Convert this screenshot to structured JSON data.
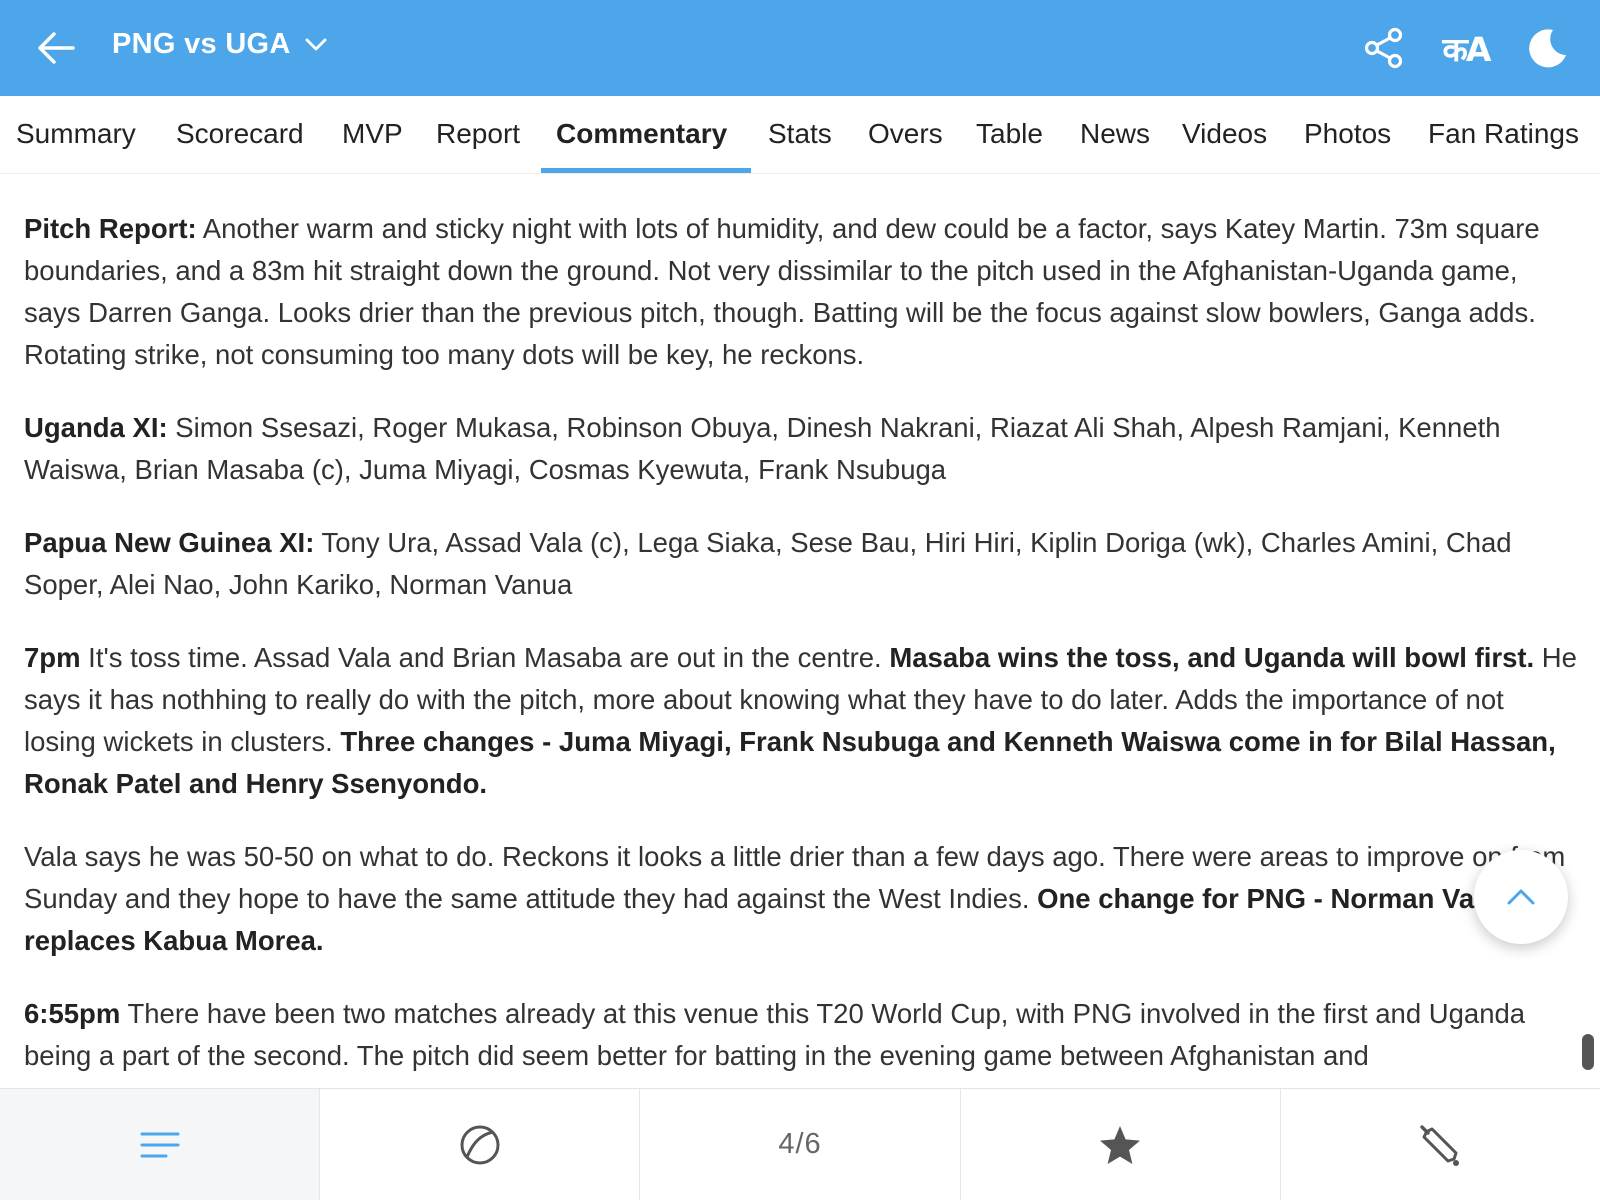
{
  "header": {
    "title": "PNG vs UGA",
    "back_icon": "arrow-left-icon",
    "dropdown_icon": "chevron-down-icon",
    "share_icon": "share-icon",
    "language_label": "कA",
    "theme_icon": "moon-icon",
    "bg_color": "#4ea6ea"
  },
  "tabs": [
    {
      "label": "Summary"
    },
    {
      "label": "Scorecard"
    },
    {
      "label": "MVP"
    },
    {
      "label": "Report"
    },
    {
      "label": "Commentary",
      "active": true
    },
    {
      "label": "Stats"
    },
    {
      "label": "Overs"
    },
    {
      "label": "Table"
    },
    {
      "label": "News"
    },
    {
      "label": "Videos"
    },
    {
      "label": "Photos"
    },
    {
      "label": "Fan Ratings"
    }
  ],
  "commentary": [
    {
      "segments": [
        {
          "text": "Pitch Report:",
          "bold": true
        },
        {
          "text": " Another warm and sticky night with lots of humidity, and dew could be a factor, says Katey Martin. 73m square boundaries, and a 83m hit straight down the ground. Not very dissimilar to the pitch used in the Afghanistan-Uganda game, says Darren Ganga. Looks drier than the previous pitch, though. Batting will be the focus against slow bowlers, Ganga adds. Rotating strike, not consuming too many dots will be key, he reckons.",
          "bold": false
        }
      ]
    },
    {
      "segments": [
        {
          "text": "Uganda XI:",
          "bold": true
        },
        {
          "text": " Simon Ssesazi, Roger Mukasa, Robinson Obuya, Dinesh Nakrani, Riazat Ali Shah, Alpesh Ramjani, Kenneth Waiswa, Brian Masaba (c), Juma Miyagi, Cosmas Kyewuta, Frank Nsubuga",
          "bold": false
        }
      ]
    },
    {
      "segments": [
        {
          "text": "Papua New Guinea XI:",
          "bold": true
        },
        {
          "text": " Tony Ura, Assad Vala (c), Lega Siaka, Sese Bau, Hiri Hiri, Kiplin Doriga (wk), Charles Amini, Chad Soper, Alei Nao, John Kariko, Norman Vanua",
          "bold": false
        }
      ]
    },
    {
      "segments": [
        {
          "text": "7pm",
          "bold": true
        },
        {
          "text": " It's toss time. Assad Vala and Brian Masaba are out in the centre. ",
          "bold": false
        },
        {
          "text": "Masaba wins the toss, and Uganda will bowl first.",
          "bold": true
        },
        {
          "text": " He says it has nothhing to really do with the pitch, more about knowing what they have to do later. Adds the importance of not losing wickets in clusters. ",
          "bold": false
        },
        {
          "text": "Three changes - Juma Miyagi, Frank Nsubuga and Kenneth Waiswa come in for Bilal Hassan, Ronak Patel and Henry Ssenyondo.",
          "bold": true
        }
      ]
    },
    {
      "segments": [
        {
          "text": "Vala says he was 50-50 on what to do. Reckons it looks a little drier than a few days ago. There were areas to improve on from Sunday and they hope to have the same attitude they had against the West Indies. ",
          "bold": false
        },
        {
          "text": "One change for PNG - Norman Vanua replaces Kabua Morea.",
          "bold": true
        }
      ]
    },
    {
      "segments": [
        {
          "text": "6:55pm",
          "bold": true
        },
        {
          "text": " There have been two matches already at this venue this T20 World Cup, with PNG involved in the first and Uganda being a part of the second. The pitch did seem better for batting in the evening game between Afghanistan and",
          "bold": false
        }
      ]
    }
  ],
  "scroll_top_icon": "chevron-up-icon",
  "bottom_nav": {
    "items": [
      {
        "icon": "menu-lines-icon",
        "active": true
      },
      {
        "icon": "cricket-ball-icon"
      },
      {
        "label": "4/6"
      },
      {
        "icon": "star-icon"
      },
      {
        "icon": "cricket-bat-icon"
      }
    ],
    "accent_color": "#4ea6ea"
  }
}
